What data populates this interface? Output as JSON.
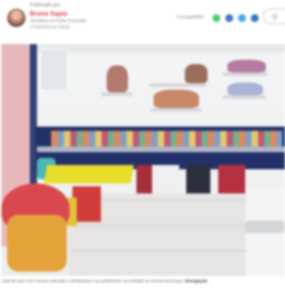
{
  "author": {
    "posted_by_label": "Publicado por",
    "name": "Bruna Sapia",
    "role": "Jornalista no Portal Sorocaba",
    "date": "17/03/2023 às 10h15"
  },
  "share": {
    "label": "Compartilhe",
    "icons": [
      "whatsapp-icon",
      "facebook-icon",
      "twitter-icon",
      "linkedin-icon"
    ]
  },
  "search": {
    "glyph": "Q"
  },
  "photo": {
    "caption": "Sala de aula com mesas coloridas e brinquedos nas prateleiras na unidade da escola municipal.",
    "credit": "Divulgação"
  }
}
